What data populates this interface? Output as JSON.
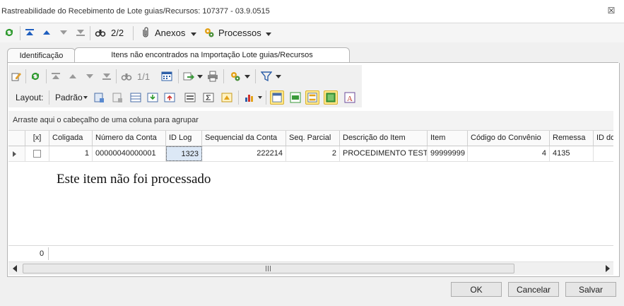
{
  "window": {
    "title": "Rastreabilidade do Recebimento de Lote guias/Recursos: 107377 - 03.9.0515",
    "close_glyph": "☒"
  },
  "toolbar": {
    "counter": "2/2",
    "anexos_label": "Anexos",
    "processos_label": "Processos"
  },
  "tabs": [
    {
      "label": "Identificação"
    },
    {
      "label": "Itens não encontrados na Importação Lote guias/Recursos"
    }
  ],
  "grid_toolbar": {
    "counter": "1/1",
    "layout_label": "Layout:",
    "layout_value": "Padrão"
  },
  "grid": {
    "group_hint": "Arraste aqui o cabeçalho de uma coluna para agrupar",
    "columns": [
      "[x]",
      "Coligada",
      "Número da Conta",
      "ID Log",
      "Sequencial da Conta",
      "Seq. Parcial",
      "Descrição do Item",
      "Item",
      "Código do Convênio",
      "Remessa",
      "ID do"
    ],
    "rows": [
      {
        "coligada": "1",
        "numero_conta": "00000040000001",
        "id_log": "1323",
        "sequencial": "222214",
        "seq_parcial": "2",
        "descricao": "PROCEDIMENTO TESTE",
        "item": "99999999",
        "codigo_convenio": "4",
        "remessa": "4135"
      }
    ],
    "footer_count": "0"
  },
  "message": "Este item não foi processado",
  "buttons": {
    "ok": "OK",
    "cancel": "Cancelar",
    "save": "Salvar"
  },
  "colors": {
    "accent_blue": "#1f5fbf",
    "refresh_green": "#2e9a2e",
    "highlight_yellow": "#ffe88a"
  }
}
